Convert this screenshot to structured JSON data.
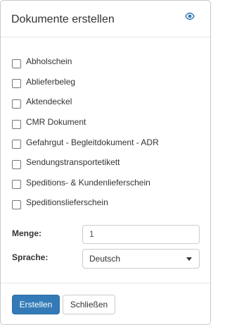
{
  "dialog": {
    "title": "Dokumente erstellen",
    "header_icon": "eye-icon"
  },
  "documents": [
    {
      "label": "Abholschein",
      "checked": false
    },
    {
      "label": "Ablieferbeleg",
      "checked": false
    },
    {
      "label": "Aktendeckel",
      "checked": false
    },
    {
      "label": "CMR Dokument",
      "checked": false
    },
    {
      "label": "Gefahrgut - Begleitdokument - ADR",
      "checked": false
    },
    {
      "label": "Sendungstransportetikett",
      "checked": false
    },
    {
      "label": "Speditions- & Kundenlieferschein",
      "checked": false
    },
    {
      "label": "Speditionslieferschein",
      "checked": false
    }
  ],
  "form": {
    "menge_label": "Menge:",
    "menge_value": "1",
    "sprache_label": "Sprache:",
    "sprache_value": "Deutsch"
  },
  "footer": {
    "create_label": "Erstellen",
    "close_label": "Schließen"
  },
  "colors": {
    "primary": "#337ab7",
    "eye_icon": "#337ab7"
  }
}
